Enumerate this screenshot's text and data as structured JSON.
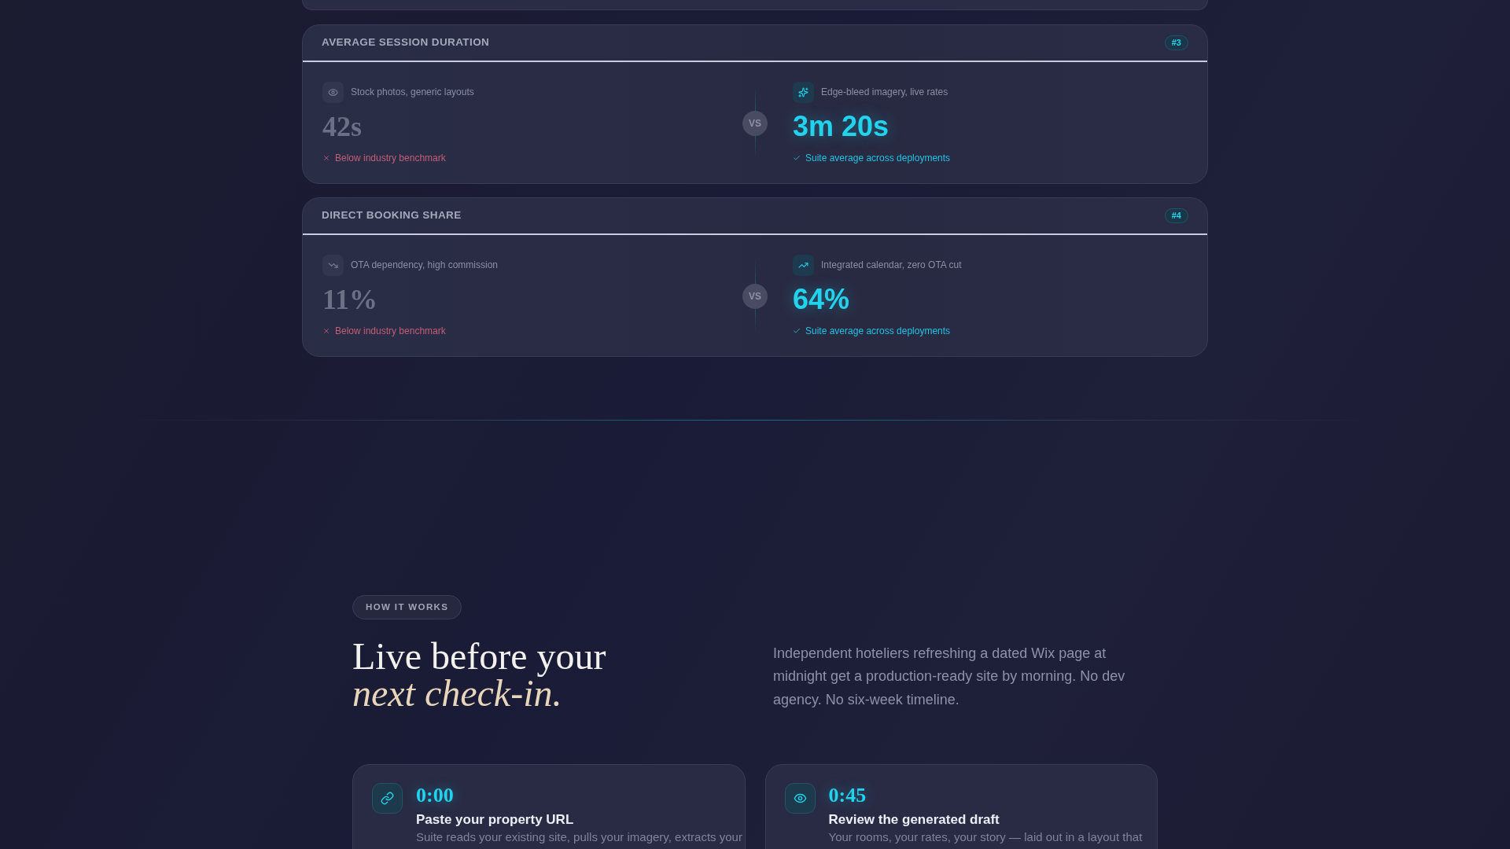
{
  "metrics": [
    {
      "title": "AVERAGE SESSION DURATION",
      "rank": "#3",
      "before": {
        "caption": "Stock photos, generic layouts",
        "value": "42s",
        "verdict": "Below industry benchmark"
      },
      "divider": "VS",
      "after": {
        "caption": "Edge-bleed imagery, live rates",
        "value": "3m 20s",
        "verdict": "Suite average across deployments"
      }
    },
    {
      "title": "DIRECT BOOKING SHARE",
      "rank": "#4",
      "before": {
        "caption": "OTA dependency, high commission",
        "value": "11%",
        "verdict": "Below industry benchmark"
      },
      "divider": "VS",
      "after": {
        "caption": "Integrated calendar, zero OTA cut",
        "value": "64%",
        "verdict": "Suite average across deployments"
      }
    }
  ],
  "how_it_works": {
    "label": "HOW IT WORKS",
    "heading": "Live before your",
    "heading_accent": "next check-in.",
    "intro": "Independent hoteliers refreshing a dated Wix page at midnight get a production-ready site by morning. No dev agency. No six-week timeline.",
    "steps": [
      {
        "time": "0:00",
        "title": "Paste your property URL",
        "text": "Suite reads your existing site, pulls your imagery, extracts your"
      },
      {
        "time": "0:45",
        "title": "Review the generated draft",
        "text": "Your rooms, your rates, your story — laid out in a layout that"
      }
    ]
  }
}
